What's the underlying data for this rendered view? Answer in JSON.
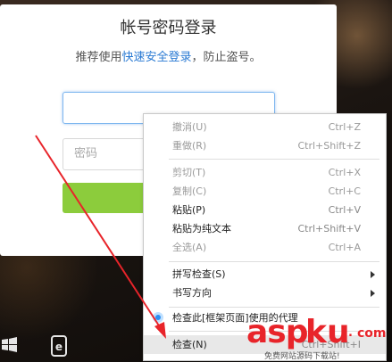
{
  "login": {
    "title": "帐号密码登录",
    "subtitle_prefix": "推荐使用",
    "subtitle_link": "快速安全登录",
    "subtitle_suffix": "，防止盗号。",
    "account_value": "",
    "password_placeholder": "密码"
  },
  "context_menu": {
    "items": [
      {
        "label": "撤消(U)",
        "shortcut": "Ctrl+Z",
        "enabled": false
      },
      {
        "label": "重做(R)",
        "shortcut": "Ctrl+Shift+Z",
        "enabled": false
      },
      {
        "label": "剪切(T)",
        "shortcut": "Ctrl+X",
        "enabled": false
      },
      {
        "label": "复制(C)",
        "shortcut": "Ctrl+C",
        "enabled": false
      },
      {
        "label": "粘贴(P)",
        "shortcut": "Ctrl+V",
        "enabled": true
      },
      {
        "label": "粘贴为纯文本",
        "shortcut": "Ctrl+Shift+V",
        "enabled": true
      },
      {
        "label": "全选(A)",
        "shortcut": "Ctrl+A",
        "enabled": false
      },
      {
        "label": "拼写检查(S)",
        "shortcut": "",
        "enabled": true,
        "submenu": true
      },
      {
        "label": "书写方向",
        "shortcut": "",
        "enabled": true,
        "submenu": true
      },
      {
        "label": "检查此[框架页面]使用的代理",
        "shortcut": "",
        "enabled": true
      },
      {
        "label": "检查(N)",
        "shortcut": "Ctrl+Shift+I",
        "enabled": true
      }
    ]
  },
  "watermark": {
    "brand_a": "asp",
    "brand_b": "ku",
    "brand_dot": ".",
    "brand_tld": "com",
    "tagline": "免费网站源码下载站!"
  },
  "colors": {
    "accent": "#8ccc3c",
    "link": "#2a7ad3",
    "arrow": "#e8242a"
  }
}
